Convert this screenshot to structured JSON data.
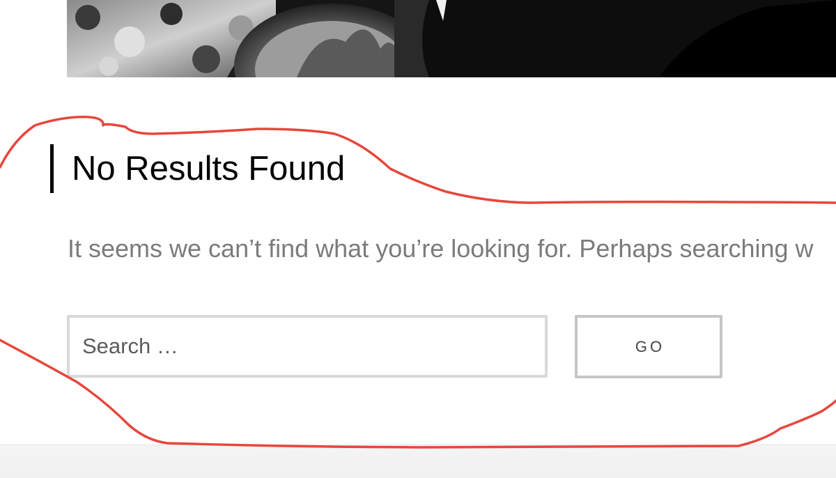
{
  "hero": {
    "image_description": "black-and-white photograph"
  },
  "main": {
    "title": "No Results Found",
    "message": "It seems we can’t find what you’re looking for. Perhaps searching w"
  },
  "search": {
    "placeholder": "Search …",
    "button_label": "GO"
  },
  "annotation": {
    "color": "#e8463c"
  }
}
